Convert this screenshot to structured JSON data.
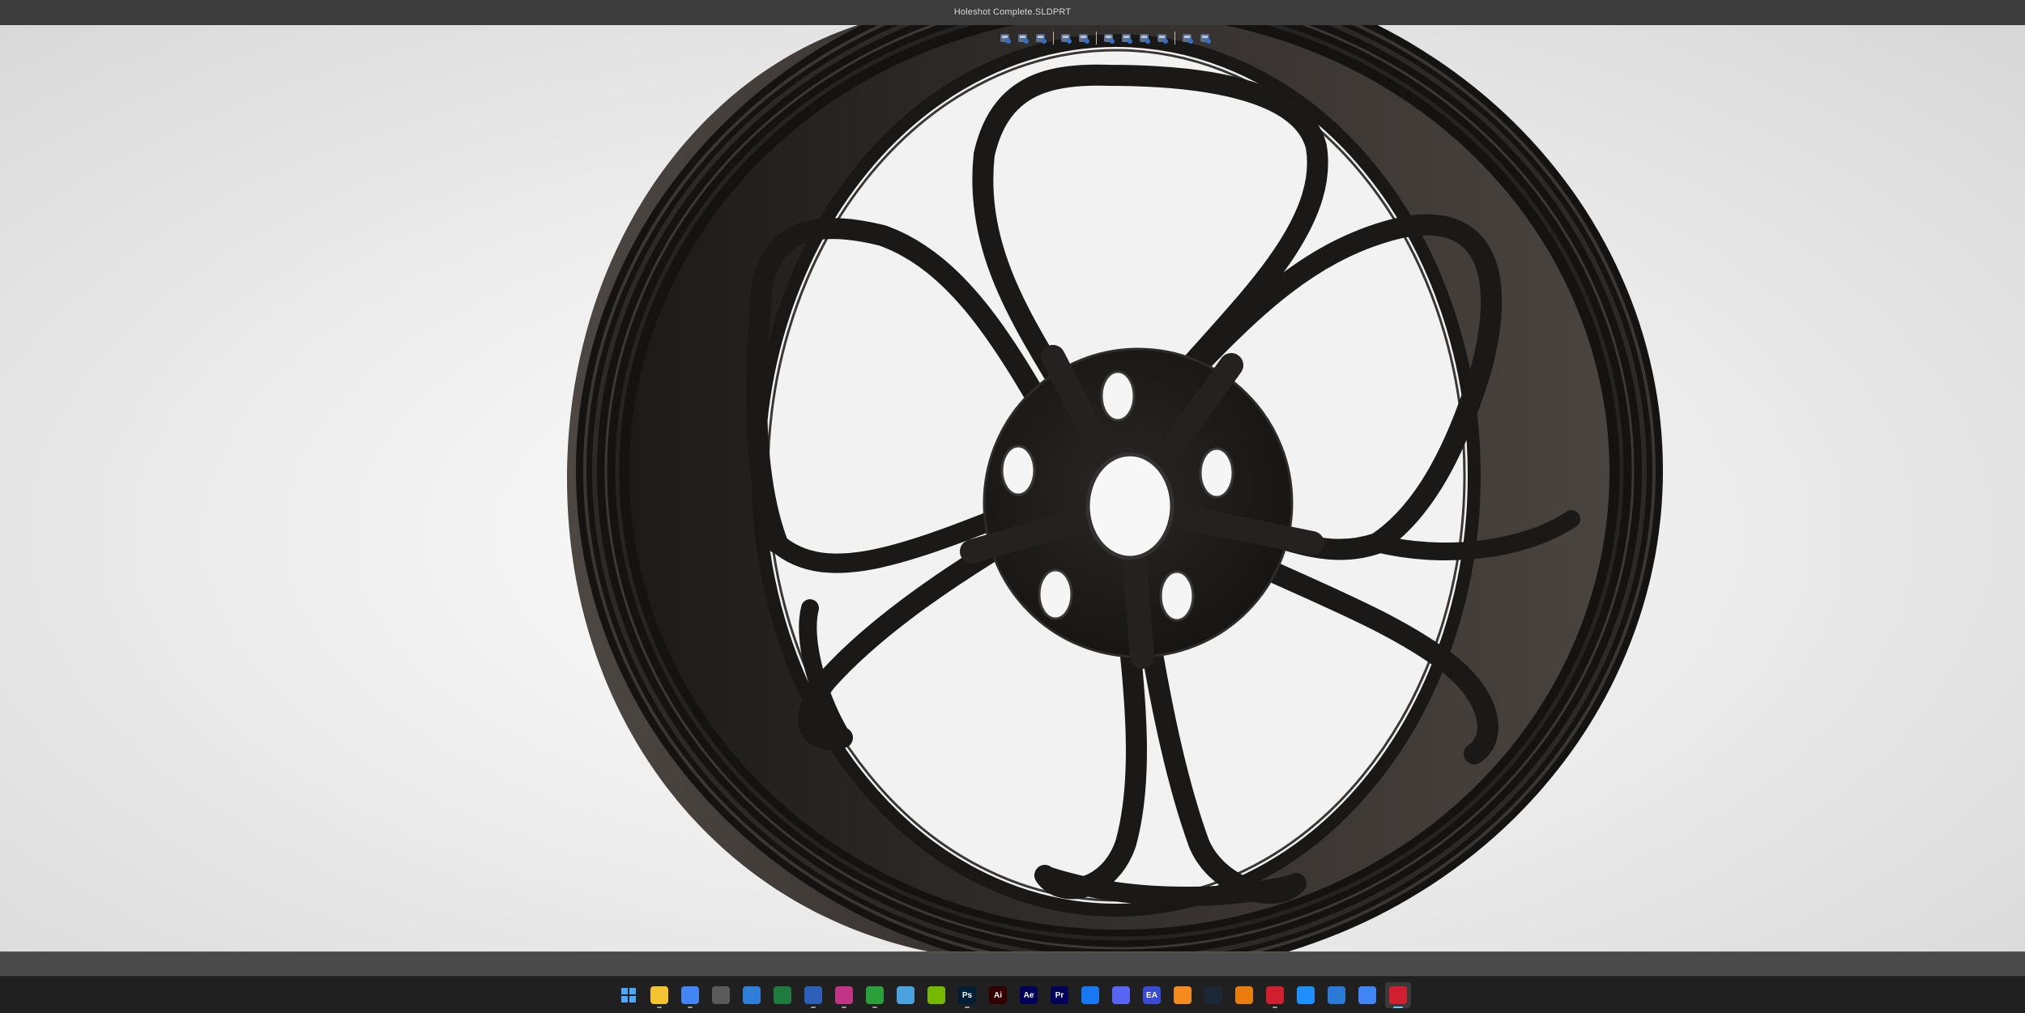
{
  "window": {
    "title": "Holeshot Complete.SLDPRT"
  },
  "heads_up_toolbar": {
    "tools": [
      {
        "icon": "zoom-to-fit-icon"
      },
      {
        "icon": "zoom-to-area-icon"
      },
      {
        "icon": "previous-view-icon"
      },
      {
        "icon": "section-view-icon"
      },
      {
        "icon": "dynamic-annotation-icon"
      },
      {
        "icon": "view-orientation-icon"
      },
      {
        "icon": "display-style-icon"
      },
      {
        "icon": "hide-show-items-icon"
      },
      {
        "icon": "edit-appearance-icon"
      },
      {
        "icon": "apply-scene-icon"
      },
      {
        "icon": "view-settings-icon"
      }
    ]
  },
  "viewport": {
    "model": "wheel-rim",
    "spokes": 5,
    "lug_holes": 5,
    "background": "#ebebeb",
    "model_color": "#1d1b1a"
  },
  "taskbar": {
    "items": [
      {
        "name": "start",
        "icon": "windows-start-icon",
        "glyph": "",
        "color": "#1e90ff"
      },
      {
        "name": "file-explorer",
        "icon": "folder-icon",
        "glyph": "",
        "color": "#f4c430",
        "running": true
      },
      {
        "name": "chrome-1",
        "icon": "chrome-icon",
        "glyph": "",
        "color": "#4285f4",
        "running": true
      },
      {
        "name": "calculator",
        "icon": "calculator-icon",
        "glyph": "",
        "color": "#5a5a5a"
      },
      {
        "name": "store",
        "icon": "store-icon",
        "glyph": "",
        "color": "#2f7fd8"
      },
      {
        "name": "excel",
        "icon": "excel-icon",
        "glyph": "",
        "color": "#1f7a3e"
      },
      {
        "name": "word",
        "icon": "word-icon",
        "glyph": "",
        "color": "#2b5fb8",
        "running": true
      },
      {
        "name": "instagram",
        "icon": "camera-app-icon",
        "glyph": "",
        "color": "#c13584",
        "running": true
      },
      {
        "name": "xbox",
        "icon": "xbox-icon",
        "glyph": "",
        "color": "#2aa03a",
        "running": true
      },
      {
        "name": "notes",
        "icon": "notes-icon",
        "glyph": "",
        "color": "#4aa3df"
      },
      {
        "name": "nvidia",
        "icon": "nvidia-icon",
        "glyph": "",
        "color": "#76b900"
      },
      {
        "name": "photoshop",
        "icon": "photoshop-icon",
        "glyph": "Ps",
        "color": "#001e36",
        "running": true
      },
      {
        "name": "illustrator",
        "icon": "illustrator-icon",
        "glyph": "Ai",
        "color": "#330000"
      },
      {
        "name": "after-effects",
        "icon": "after-effects-icon",
        "glyph": "Ae",
        "color": "#00005b"
      },
      {
        "name": "premiere",
        "icon": "premiere-icon",
        "glyph": "Pr",
        "color": "#00005b"
      },
      {
        "name": "messenger",
        "icon": "messenger-icon",
        "glyph": "",
        "color": "#1877f2"
      },
      {
        "name": "discord",
        "icon": "discord-icon",
        "glyph": "",
        "color": "#5865f2"
      },
      {
        "name": "ea",
        "icon": "ea-app-icon",
        "glyph": "EA",
        "color": "#3a4bd6"
      },
      {
        "name": "fusion",
        "icon": "fusion-icon",
        "glyph": "",
        "color": "#f58a1f"
      },
      {
        "name": "steam",
        "icon": "steam-icon",
        "glyph": "",
        "color": "#1b2838"
      },
      {
        "name": "blender",
        "icon": "blender-icon",
        "glyph": "",
        "color": "#e87d0d"
      },
      {
        "name": "solidworks-1",
        "icon": "solidworks-icon",
        "glyph": "",
        "color": "#d11f2f",
        "running": true
      },
      {
        "name": "3d-viewer",
        "icon": "3d-box-icon",
        "glyph": "",
        "color": "#1e90ff"
      },
      {
        "name": "pen-app",
        "icon": "pen-app-icon",
        "glyph": "",
        "color": "#2a7ad8"
      },
      {
        "name": "chrome-2",
        "icon": "chrome-icon",
        "glyph": "",
        "color": "#4285f4"
      },
      {
        "name": "solidworks-2",
        "icon": "solidworks-icon",
        "glyph": "",
        "color": "#d11f2f",
        "running": true,
        "active": true
      }
    ]
  }
}
